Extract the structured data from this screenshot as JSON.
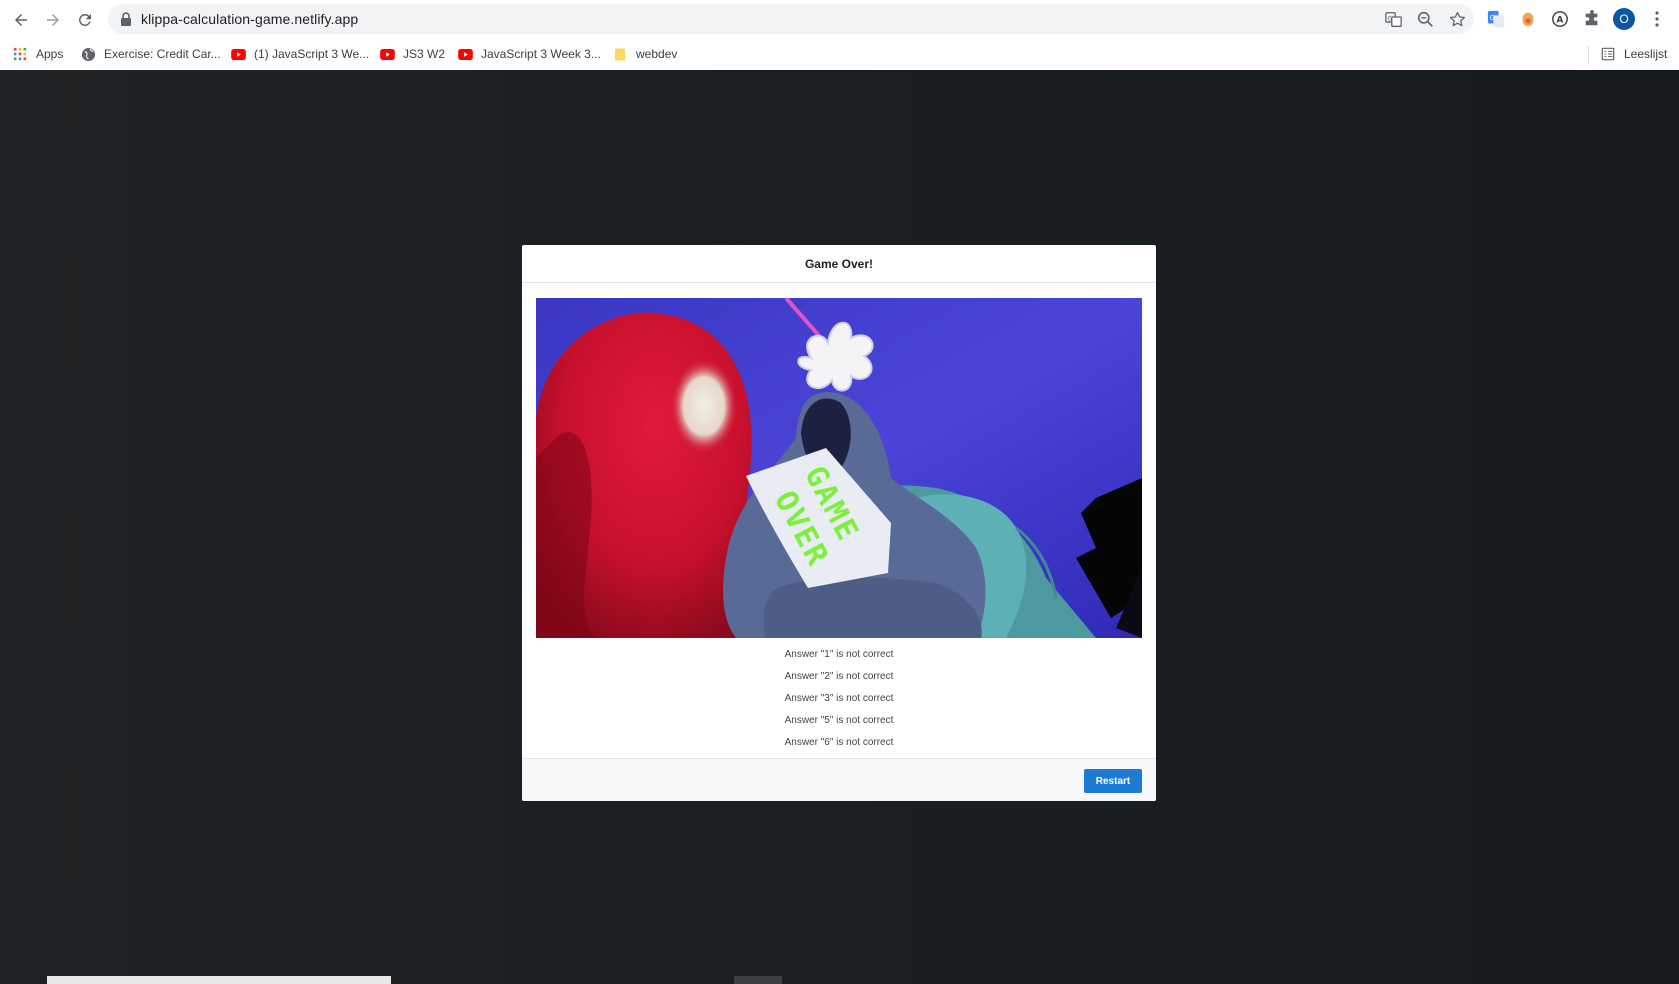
{
  "browser": {
    "url": "klippa-calculation-game.netlify.app",
    "bookmarks": [
      {
        "label": "Apps",
        "icon": "apps-grid-icon"
      },
      {
        "label": "Exercise: Credit Car...",
        "icon": "globe-icon"
      },
      {
        "label": "(1) JavaScript 3 We...",
        "icon": "youtube-icon"
      },
      {
        "label": "JS3 W2",
        "icon": "youtube-icon"
      },
      {
        "label": "JavaScript 3 Week 3...",
        "icon": "youtube-icon"
      },
      {
        "label": "webdev",
        "icon": "folder-icon"
      }
    ],
    "reading_list": "Leeslijst",
    "profile_initial": "O"
  },
  "modal": {
    "title": "Game Over!",
    "image_text": "GAME OVER",
    "answers": [
      "Answer \"1\" is not correct",
      "Answer \"2\" is not correct",
      "Answer \"3\" is not correct",
      "Answer \"5\" is not correct",
      "Answer \"6\" is not correct"
    ],
    "restart_label": "Restart"
  },
  "colors": {
    "accent": "#1e7bd4",
    "backdrop": "#1c2124",
    "image_sky": "#4f46d6"
  }
}
